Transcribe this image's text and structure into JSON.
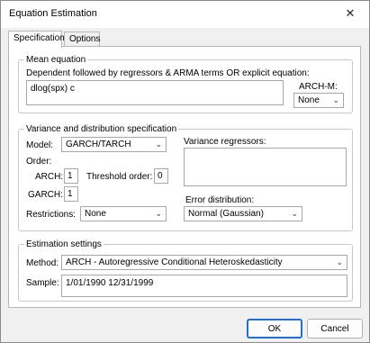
{
  "window": {
    "title": "Equation Estimation"
  },
  "tabs": [
    {
      "label": "Specification",
      "active": true
    },
    {
      "label": "Options",
      "active": false
    }
  ],
  "mean_equation": {
    "group_title": "Mean equation",
    "instruction": "Dependent followed by regressors & ARMA terms OR explicit equation:",
    "equation_value": "dlog(spx) c",
    "archm_label": "ARCH-M:",
    "archm_value": "None"
  },
  "variance": {
    "group_title": "Variance and distribution specification",
    "model_label": "Model:",
    "model_value": "GARCH/TARCH",
    "order_label": "Order:",
    "arch_label": "ARCH:",
    "arch_value": "1",
    "threshold_label": "Threshold order:",
    "threshold_value": "0",
    "garch_label": "GARCH:",
    "garch_value": "1",
    "restrictions_label": "Restrictions:",
    "restrictions_value": "None",
    "variance_regressors_label": "Variance regressors:",
    "variance_regressors_value": "",
    "error_distribution_label": "Error distribution:",
    "error_distribution_value": "Normal (Gaussian)"
  },
  "estimation": {
    "group_title": "Estimation settings",
    "method_label": "Method:",
    "method_value": "ARCH  -  Autoregressive Conditional Heteroskedasticity",
    "sample_label": "Sample:",
    "sample_value": "1/01/1990 12/31/1999"
  },
  "buttons": {
    "ok": "OK",
    "cancel": "Cancel"
  },
  "icons": {
    "close": "close-icon",
    "chevron": "chevron-down-icon"
  }
}
